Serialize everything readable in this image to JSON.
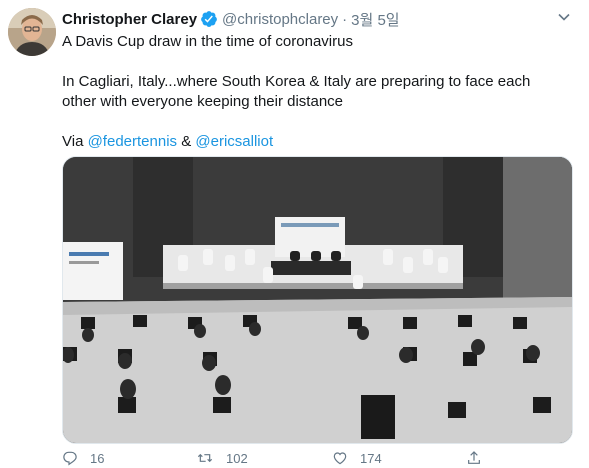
{
  "tweet": {
    "author_name": "Christopher Clarey",
    "handle": "@christophclarey",
    "separator": "·",
    "time": "3월 5일",
    "line1": "A Davis Cup draw in the time of coronavirus",
    "line2": "In Cagliari, Italy...where South Korea & Italy are preparing to face each",
    "line3": "other with everyone keeping their distance",
    "via_prefix": "Via ",
    "mention1": "@federtennis",
    "amp": " & ",
    "mention2": "@ericsalliot"
  },
  "actions": {
    "replies": "16",
    "retweets": "102",
    "likes": "174"
  },
  "colors": {
    "link": "#1b95e0",
    "verified": "#1da1f2",
    "secondary_text": "#657786"
  },
  "icons": [
    "verified-badge-icon",
    "chevron-down-icon",
    "reply-icon",
    "retweet-icon",
    "like-icon",
    "share-icon"
  ]
}
